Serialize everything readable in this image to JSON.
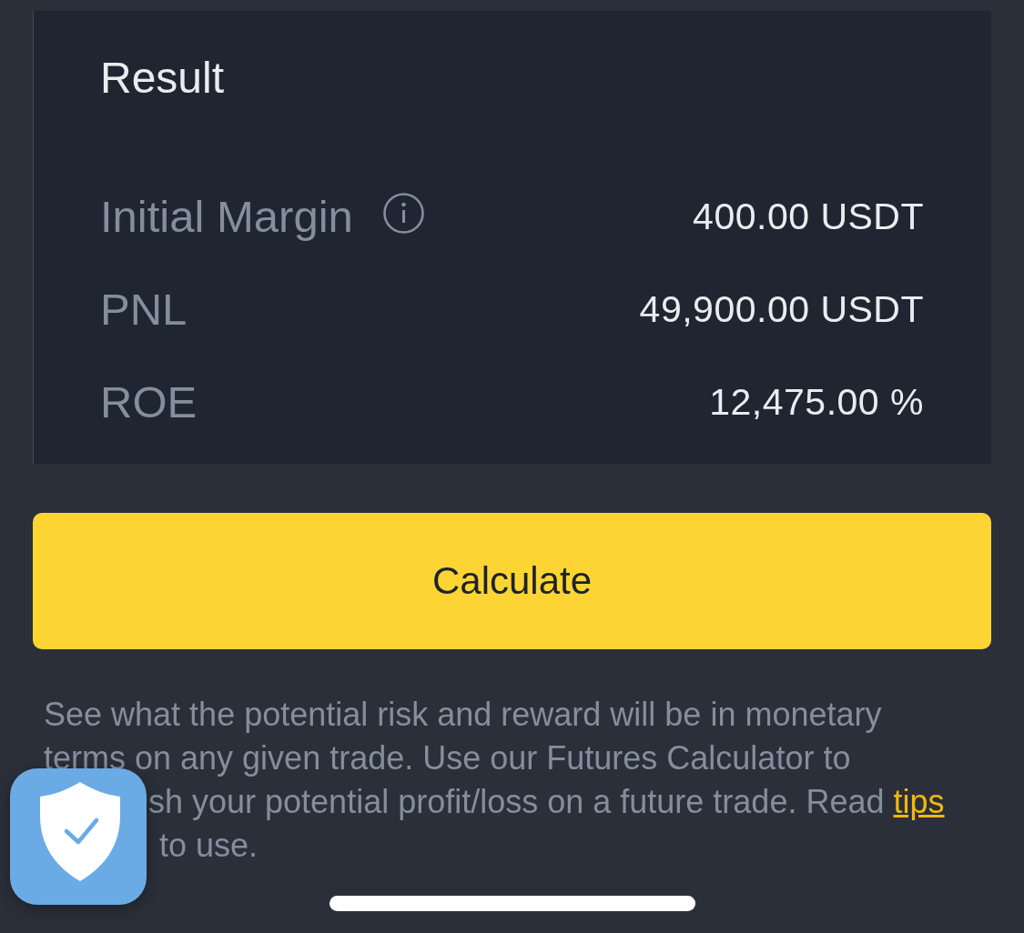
{
  "result_card": {
    "title": "Result",
    "rows": [
      {
        "label": "Initial Margin",
        "info": true,
        "value": "400.00 USDT"
      },
      {
        "label": "PNL",
        "info": false,
        "value": "49,900.00 USDT"
      },
      {
        "label": "ROE",
        "info": false,
        "value": "12,475.00 %"
      }
    ]
  },
  "calculate_button": {
    "label": "Calculate"
  },
  "description": {
    "text": "See what the potential risk and reward will be in monetary terms on any given trade. Use our Futures Calculator to",
    "covered_lines": [
      {
        "text": "sh your potential profit/loss on a future trade. Read",
        "link": "tips"
      },
      {
        "text": "to use."
      }
    ]
  }
}
